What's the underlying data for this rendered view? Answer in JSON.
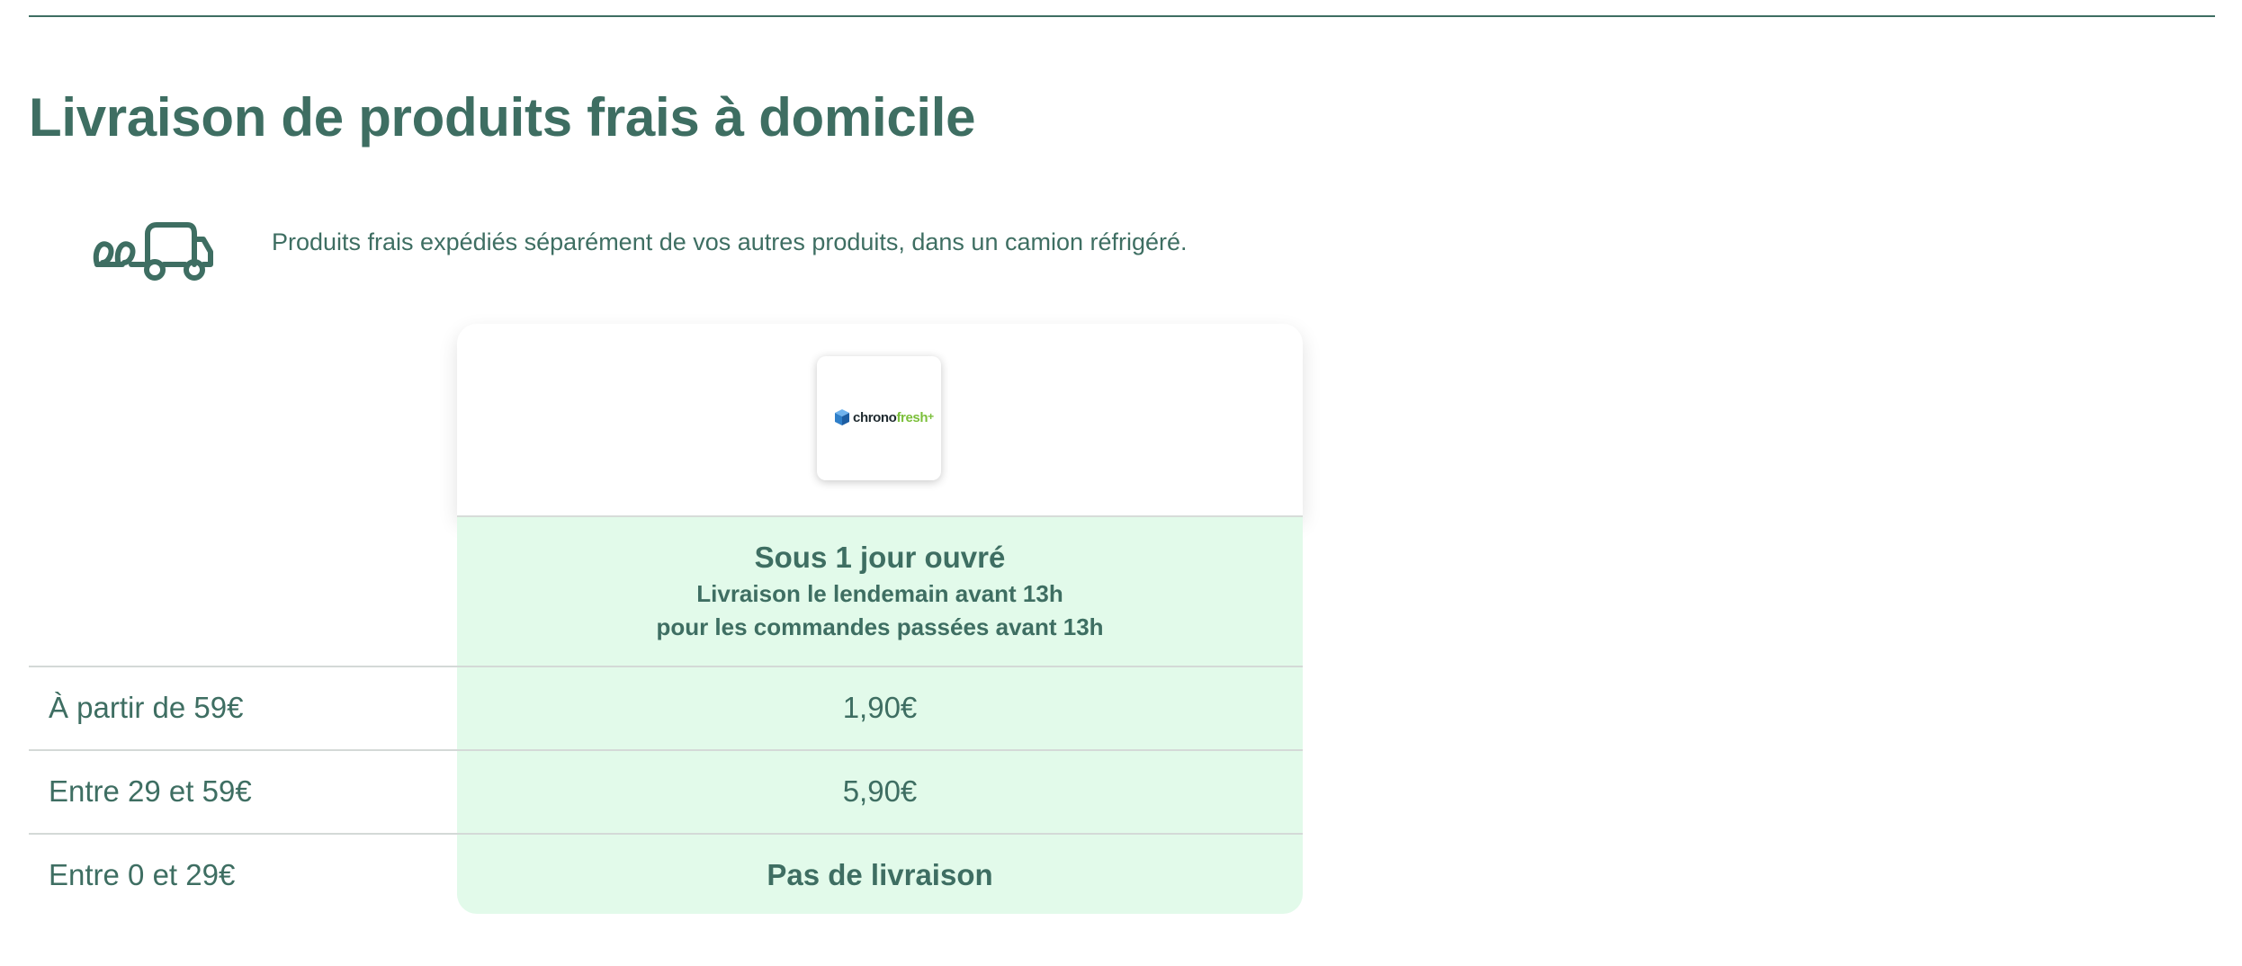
{
  "page": {
    "title": "Livraison de produits frais à domicile",
    "intro": "Produits frais expédiés séparément de vos autres produits, dans un camion réfrigéré.",
    "intro_icon": "refrigerated-truck-icon"
  },
  "carrier": {
    "logo_parts": [
      "chrono",
      "fresh",
      "+"
    ],
    "logo_icon": "chronofresh-cube-icon"
  },
  "service": {
    "title": "Sous 1 jour ouvré",
    "subtitle_line1": "Livraison le lendemain avant 13h",
    "subtitle_line2": "pour les commandes passées avant 13h"
  },
  "rows": [
    {
      "label": "À partir de 59€",
      "value": "1,90€"
    },
    {
      "label": "Entre 29 et 59€",
      "value": "5,90€"
    },
    {
      "label": "Entre 0 et 29€",
      "value": "Pas de livraison"
    }
  ],
  "colors": {
    "text": "#3e6e62",
    "green_bg": "#e2faea",
    "logo_fresh": "#7bbf3a",
    "logo_cube": "#3f8fd6"
  }
}
